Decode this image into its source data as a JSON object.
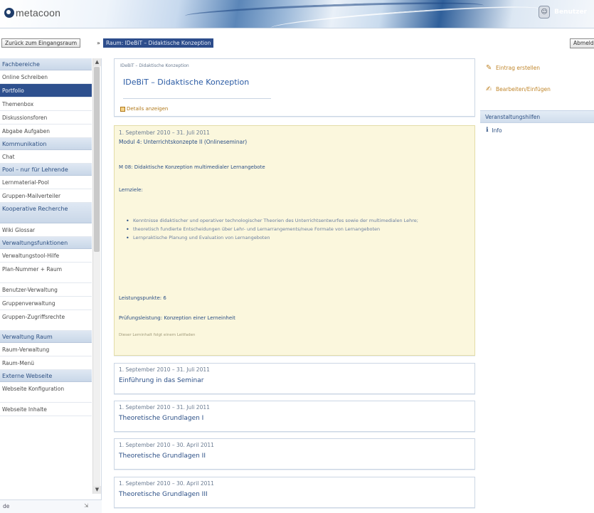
{
  "header": {
    "logo_text": "metacoon",
    "user_name": "Benutzer"
  },
  "navbar": {
    "back_label": "Zurück zum Eingangsraum",
    "separator": "»",
    "breadcrumb": "Raum: IDeBiT – Didaktische Konzeption",
    "right_label": "Abmelden"
  },
  "sidebar": {
    "sections": [
      {
        "heading": "Fachbereiche",
        "items": [
          {
            "label": "Online Schreiben",
            "active": false
          },
          {
            "label": "Portfolio",
            "active": true
          },
          {
            "label": "Themenbox",
            "active": false
          },
          {
            "label": "Diskussionsforen",
            "active": false
          },
          {
            "label": "Abgabe Aufgaben",
            "active": false
          }
        ]
      },
      {
        "heading": "Kommunikation",
        "items": [
          {
            "label": "Chat",
            "active": false
          }
        ]
      },
      {
        "heading": "Pool – nur für Lehrende",
        "items": [
          {
            "label": "Lernmaterial-Pool",
            "active": false
          },
          {
            "label": "Gruppen-Mailverteiler",
            "active": false
          }
        ]
      },
      {
        "heading": "Kooperative Recherche",
        "items": [
          {
            "label": "Wiki Glossar",
            "active": false
          }
        ]
      },
      {
        "heading": "Verwaltungsfunktionen",
        "items": [
          {
            "label": "Verwaltungstool-Hilfe",
            "active": false
          },
          {
            "label": "Plan-Nummer + Raum",
            "active": false
          },
          {
            "label": "Benutzer-Verwaltung",
            "active": false
          },
          {
            "label": "Gruppenverwaltung",
            "active": false
          },
          {
            "label": "Gruppen-Zugriffsrechte",
            "active": false
          }
        ]
      },
      {
        "heading": "Verwaltung Raum",
        "items": [
          {
            "label": "Raum-Verwaltung",
            "active": false
          },
          {
            "label": "Raum-Menü",
            "active": false
          }
        ]
      },
      {
        "heading": "Externe Webseite",
        "items": [
          {
            "label": "Webseite Konfiguration",
            "active": false
          },
          {
            "label": "Webseite Inhalte",
            "active": false
          }
        ]
      }
    ],
    "footer_lang": "de",
    "footer_pin": "⇲"
  },
  "main": {
    "head": {
      "small": "IDeBiT – Didaktische Konzeption",
      "title": "IDeBiT – Didaktische Konzeption",
      "details": "Details anzeigen"
    },
    "module": {
      "date": "1. September 2010 – 31. Juli 2011",
      "title": "Modul 4: Unterrichtskonzepte II (Onlineseminar)",
      "subtitle": "M 08: Didaktische Konzeption multimedialer Lernangebote",
      "lernziele_label": "Lernziele:",
      "bullets": [
        "Kenntnisse didaktischer und operativer technologischer Theorien des Unterrichtsentwurfes sowie der multimedialen Lehre;",
        "theoretisch fundierte Entscheidungen über Lehr- und Lernarrangements/neue Formate von Lernangeboten",
        "Lernpraktische Planung und Evaluation von Lernangeboten"
      ],
      "credits": "Leistungspunkte: 6",
      "pruefung": "Prüfungsleistung: Konzeption einer Lerneinheit",
      "note": "Dieser Lerninhalt folgt einem Leitfaden"
    },
    "sessions": [
      {
        "date": "1. September 2010 – 31. Juli 2011",
        "title": "Einführung in das Seminar"
      },
      {
        "date": "1. September 2010 – 31. Juli 2011",
        "title": "Theoretische Grundlagen I"
      },
      {
        "date": "1. September 2010 – 30. April 2011",
        "title": "Theoretische Grundlagen II"
      },
      {
        "date": "1. September 2010 – 30. April 2011",
        "title": "Theoretische Grundlagen III"
      }
    ]
  },
  "right": {
    "action1": "Eintrag erstellen",
    "action2": "Bearbeiten/Einfügen",
    "panel_title": "Veranstaltungshilfen",
    "panel_item": "Info"
  }
}
